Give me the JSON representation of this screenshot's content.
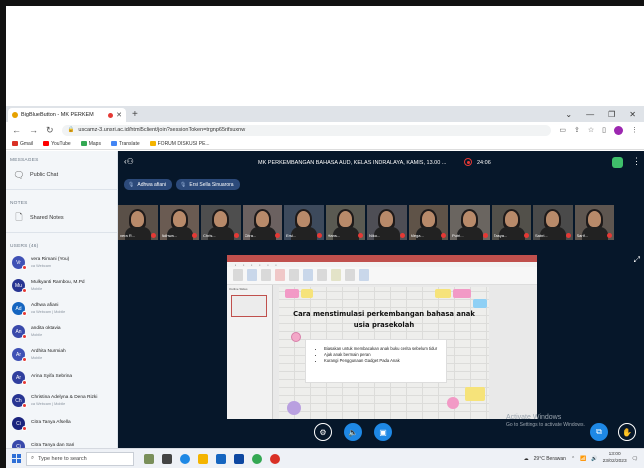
{
  "browser": {
    "tab_title": "BigBlueButton - MK PERKEM",
    "new_tab": "+",
    "url": "uscamz-3.unsri.ac.id/html5client/join?sessionToken=trgnp65rifsuxnw",
    "bookmarks": [
      "Gmail",
      "YouTube",
      "Maps",
      "Translate",
      "FORUM DISKUSI PE..."
    ],
    "window_controls": [
      "⌄",
      "—",
      "❐",
      "✕"
    ]
  },
  "sidebar": {
    "messages_title": "MESSAGES",
    "public_chat": "Public Chat",
    "notes_title": "NOTES",
    "shared_notes": "Shared Notes",
    "users_title": "USERS (46)",
    "users": [
      {
        "initials": "Vr",
        "name": "vera Rimani (You)",
        "sub": "ca Webcam",
        "color": "#3f51b5"
      },
      {
        "initials": "Mu",
        "name": "Mulkyanti Rambou, M.Pd",
        "sub": "Mobile",
        "color": "#283593"
      },
      {
        "initials": "Ad",
        "name": "Adhwa afiani",
        "sub": "ca Webcam | Mobile",
        "color": "#1565c0"
      },
      {
        "initials": "An",
        "name": "andita oktavia",
        "sub": "Mobile",
        "color": "#3949ab"
      },
      {
        "initials": "Ar",
        "name": "Ardhita Nurmiah",
        "sub": "Mobile",
        "color": "#3f51b5"
      },
      {
        "initials": "Ar",
        "name": "Arina Syifa Sebrina",
        "sub": "",
        "color": "#303f9f"
      },
      {
        "initials": "Ch",
        "name": "Christina Adelyna & Dena Rizki",
        "sub": "ca Webcam | Mobile",
        "color": "#283593"
      },
      {
        "initials": "Ci",
        "name": "Citra Tanya Afsella",
        "sub": "",
        "color": "#1a237e"
      },
      {
        "initials": "Ci",
        "name": "Citra Tanya dan Sari",
        "sub": "",
        "color": "#3949ab"
      }
    ]
  },
  "main": {
    "title": "MK PERKEMBANGAN BAHASA AUD, KELAS INDRALAYA, KAMIS, 13.00 ...",
    "rec_time": "24:06",
    "talkers": [
      "Adhwa afiani",
      "Ersi Sella Sinuarora"
    ],
    "videos": [
      "vera R...",
      "Adhwa...",
      "Chris...",
      "Citra...",
      "Ersi...",
      "Hans...",
      "Niko...",
      "Mega...",
      "Putri...",
      "Tasya...",
      "Sabri...",
      "Sarif..."
    ],
    "slide": {
      "title": "Cara menstimulasi perkembangan bahasa anak usia prasekolah",
      "bullets": [
        "Biasakan untuk membacakan anak buku cerita sebelum tidur",
        "Ajak anak bermain peran",
        "Kurangi Penggunaan Gadget Pada Anak"
      ],
      "thumb_tab": "Outline  Slides"
    },
    "watermark_title": "Activate Windows",
    "watermark_sub": "Go to Settings to activate Windows."
  },
  "taskbar": {
    "search_placeholder": "Type here to search",
    "weather": "29°C  Berawan",
    "time": "13:00",
    "date": "23/02/2023"
  },
  "colors": {
    "main_bg": "#06172a",
    "accent": "#1e88e5",
    "record": "#e53935"
  }
}
